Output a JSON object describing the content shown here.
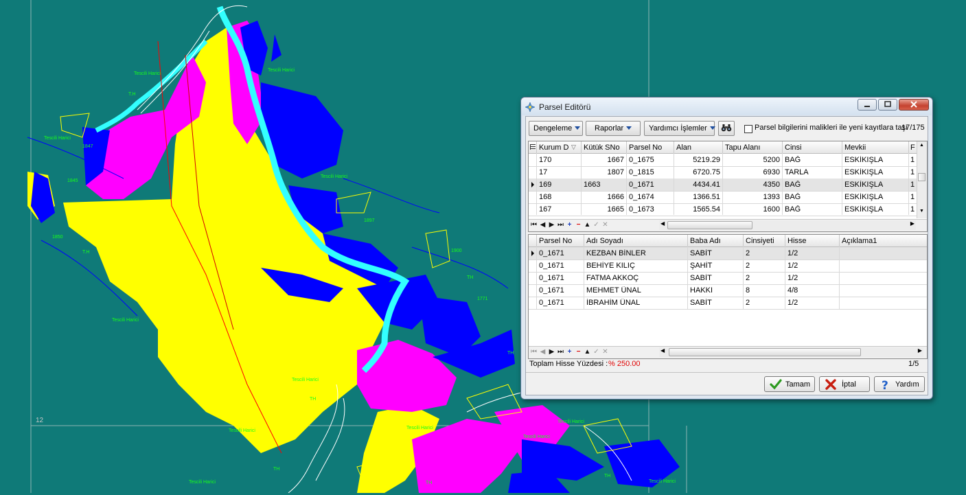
{
  "map": {
    "labels": [
      "Tescili Harici",
      "Tescili Harici",
      "Tescili Harici",
      "Tescili Harici",
      "Tescili Harici",
      "Tescili Harici",
      "Tescili Harici",
      "Tescili Harici",
      "Tescili Harici",
      "Tescili Harici",
      "Tescili Harici",
      "Tescili Harici",
      "T.H",
      "T.H",
      "TH",
      "TH",
      "TH",
      "TH",
      "TH",
      "TH",
      "1897",
      "1900",
      "1771",
      "1845",
      "1850",
      "1847",
      "12"
    ],
    "colors": {
      "background": "#0f7a78",
      "parcel_yellow": "#ffff00",
      "parcel_magenta": "#ff00ff",
      "parcel_blue": "#0000ff",
      "river": "#33ffff",
      "boundary_white": "#ffffff",
      "line_red": "#ff0000",
      "line_blue": "#0000ff"
    }
  },
  "window": {
    "title": "Parsel Editörü",
    "icon": "parcel-editor-icon",
    "controls": {
      "minimize": "minimize-icon",
      "maximize": "maximize-icon",
      "close": "close-icon"
    }
  },
  "toolbar": {
    "dengeleme": "Dengeleme",
    "raporlar": "Raporlar",
    "yardimci": "Yardımcı İşlemler",
    "search_icon": "binoculars-icon",
    "checkbox_label": "Parsel bilgilerini malikleri ile yeni kayıtlara taşı",
    "checkbox_checked": false,
    "record_count": "17/175"
  },
  "parcels": {
    "columns": [
      "Kurum D",
      "Kütük SNo",
      "Parsel No",
      "Alan",
      "Tapu Alanı",
      "Cinsi",
      "Mevkii",
      "F"
    ],
    "rows": [
      [
        "170",
        "1667",
        "0_1675",
        "5219.29",
        "5200",
        "BAĞ",
        "ESKİKIŞLA",
        "1"
      ],
      [
        "17",
        "1807",
        "0_1815",
        "6720.75",
        "6930",
        "TARLA",
        "ESKİKIŞLA",
        "1"
      ],
      [
        "169",
        "1663",
        "0_1671",
        "4434.41",
        "4350",
        "BAĞ",
        "ESKİKIŞLA",
        "1"
      ],
      [
        "168",
        "1666",
        "0_1674",
        "1366.51",
        "1393",
        "BAĞ",
        "ESKİKIŞLA",
        "1"
      ],
      [
        "167",
        "1665",
        "0_1673",
        "1565.54",
        "1600",
        "BAĞ",
        "ESKİKIŞLA",
        "1"
      ]
    ],
    "selected_row": 2
  },
  "owners": {
    "columns": [
      "Parsel No",
      "Adı Soyadı",
      "Baba Adı",
      "Cinsiyeti",
      "Hisse",
      "Açıklama1"
    ],
    "rows": [
      [
        "0_1671",
        "KEZBAN BİNLER",
        "SABİT",
        "2",
        "1/2",
        ""
      ],
      [
        "0_1671",
        "BEHİYE KILIÇ",
        "ŞAHİT",
        "2",
        "1/2",
        ""
      ],
      [
        "0_1671",
        "FATMA AKKOÇ",
        "SABİT",
        "2",
        "1/2",
        ""
      ],
      [
        "0_1671",
        "MEHMET ÜNAL",
        "HAKKI",
        "8",
        "4/8",
        ""
      ],
      [
        "0_1671",
        "İBRAHİM ÜNAL",
        "SABİT",
        "2",
        "1/2",
        ""
      ]
    ],
    "selected_row": 0
  },
  "navigator": [
    "first-icon",
    "prev-icon",
    "next-icon",
    "last-icon",
    "add-icon",
    "delete-icon",
    "edit-icon",
    "post-icon",
    "cancel-icon"
  ],
  "navigator_glyphs": [
    "⏮",
    "◀",
    "▶",
    "⏭",
    "+",
    "−",
    "▲",
    "✓",
    "✕"
  ],
  "footer": {
    "label": "Toplam Hisse Yüzdesi :",
    "value": "% 250.00",
    "count": "1/5"
  },
  "buttons": {
    "ok": "Tamam",
    "cancel": "İptal",
    "help": "Yardım"
  }
}
